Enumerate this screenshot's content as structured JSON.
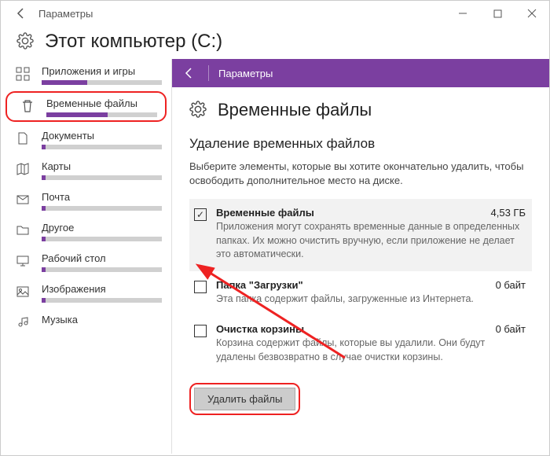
{
  "window": {
    "title": "Параметры",
    "page_heading": "Этот компьютер (C:)"
  },
  "sidebar": {
    "items": [
      {
        "label": "Приложения и игры",
        "fill": 38
      },
      {
        "label": "Временные файлы",
        "fill": 55
      },
      {
        "label": "Документы",
        "fill": 3
      },
      {
        "label": "Карты",
        "fill": 3
      },
      {
        "label": "Почта",
        "fill": 3
      },
      {
        "label": "Другое",
        "fill": 3
      },
      {
        "label": "Рабочий стол",
        "fill": 3
      },
      {
        "label": "Изображения",
        "fill": 3
      },
      {
        "label": "Музыка",
        "fill": 3
      }
    ]
  },
  "main": {
    "sub_header_title": "Параметры",
    "heading": "Временные файлы",
    "section_title": "Удаление временных файлов",
    "section_desc": "Выберите элементы, которые вы хотите окончательно удалить, чтобы освободить дополнительное место на диске.",
    "items": [
      {
        "name": "Временные файлы",
        "size": "4,53 ГБ",
        "desc": "Приложения могут сохранять временные данные в определенных папках. Их можно очистить вручную, если приложение не делает это автоматически.",
        "checked": true
      },
      {
        "name": "Папка \"Загрузки\"",
        "size": "0 байт",
        "desc": "Эта папка содержит файлы, загруженные из Интернета.",
        "checked": false
      },
      {
        "name": "Очистка корзины",
        "size": "0 байт",
        "desc": "Корзина содержит файлы, которые вы удалили. Они будут удалены безвозвратно в случае очистки корзины.",
        "checked": false
      }
    ],
    "delete_button": "Удалить файлы"
  }
}
